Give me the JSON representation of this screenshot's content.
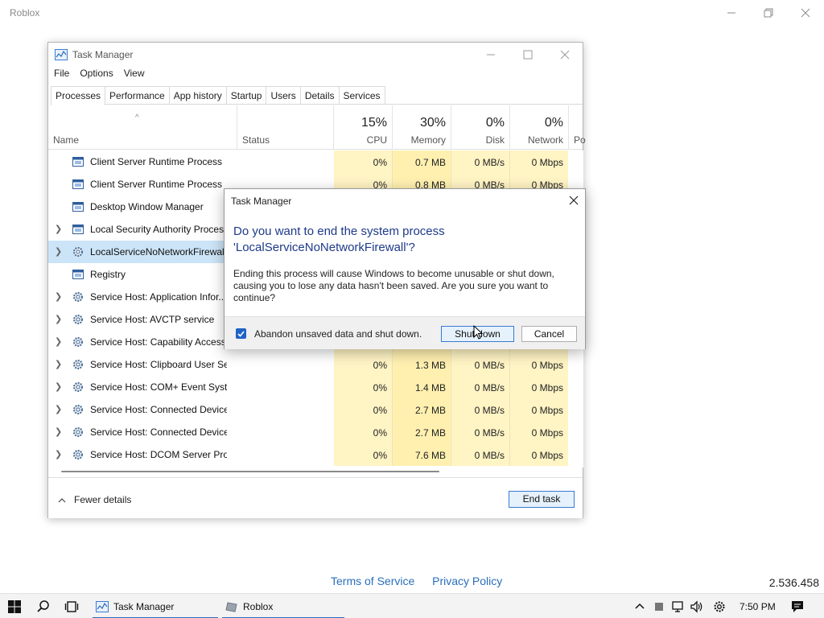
{
  "roblox": {
    "title": "Roblox",
    "links": {
      "terms": "Terms of Service",
      "privacy": "Privacy Policy"
    },
    "version": "2.536.458"
  },
  "task_manager": {
    "title": "Task Manager",
    "menu": [
      "File",
      "Options",
      "View"
    ],
    "tabs": [
      "Processes",
      "Performance",
      "App history",
      "Startup",
      "Users",
      "Details",
      "Services"
    ],
    "active_tab": "Processes",
    "columns": {
      "name": "Name",
      "status": "Status",
      "cpu": {
        "pct": "15%",
        "label": "CPU"
      },
      "memory": {
        "pct": "30%",
        "label": "Memory"
      },
      "disk": {
        "pct": "0%",
        "label": "Disk"
      },
      "network": {
        "pct": "0%",
        "label": "Network"
      },
      "power": "Po"
    },
    "processes": [
      {
        "name": "Client Server Runtime Process",
        "expandable": false,
        "icon": "window-app-icon",
        "cpu": "0%",
        "mem": "0.7 MB",
        "disk": "0 MB/s",
        "net": "0 Mbps"
      },
      {
        "name": "Client Server Runtime Process",
        "expandable": false,
        "icon": "window-app-icon",
        "cpu": "0%",
        "mem": "0.8 MB",
        "disk": "0 MB/s",
        "net": "0 Mbps"
      },
      {
        "name": "Desktop Window Manager",
        "expandable": false,
        "icon": "window-app-icon",
        "cpu": "",
        "mem": "",
        "disk": "",
        "net": ""
      },
      {
        "name": "Local Security Authority Process",
        "expandable": true,
        "icon": "window-app-icon",
        "cpu": "",
        "mem": "",
        "disk": "",
        "net": ""
      },
      {
        "name": "LocalServiceNoNetworkFirewall",
        "expandable": true,
        "icon": "gear-icon",
        "selected": true,
        "cpu": "",
        "mem": "",
        "disk": "",
        "net": ""
      },
      {
        "name": "Registry",
        "expandable": false,
        "icon": "window-app-icon",
        "cpu": "",
        "mem": "",
        "disk": "",
        "net": ""
      },
      {
        "name": "Service Host: Application Infor...",
        "expandable": true,
        "icon": "gear-icon",
        "cpu": "",
        "mem": "",
        "disk": "",
        "net": ""
      },
      {
        "name": "Service Host: AVCTP service",
        "expandable": true,
        "icon": "gear-icon",
        "cpu": "",
        "mem": "",
        "disk": "",
        "net": ""
      },
      {
        "name": "Service Host: Capability Access ...",
        "expandable": true,
        "icon": "gear-icon",
        "cpu": "",
        "mem": "",
        "disk": "",
        "net": ""
      },
      {
        "name": "Service Host: Clipboard User Ser...",
        "expandable": true,
        "icon": "gear-icon",
        "cpu": "0%",
        "mem": "1.3 MB",
        "disk": "0 MB/s",
        "net": "0 Mbps"
      },
      {
        "name": "Service Host: COM+ Event Syste...",
        "expandable": true,
        "icon": "gear-icon",
        "cpu": "0%",
        "mem": "1.4 MB",
        "disk": "0 MB/s",
        "net": "0 Mbps"
      },
      {
        "name": "Service Host: Connected Device...",
        "expandable": true,
        "icon": "gear-icon",
        "cpu": "0%",
        "mem": "2.7 MB",
        "disk": "0 MB/s",
        "net": "0 Mbps"
      },
      {
        "name": "Service Host: Connected Device...",
        "expandable": true,
        "icon": "gear-icon",
        "cpu": "0%",
        "mem": "2.7 MB",
        "disk": "0 MB/s",
        "net": "0 Mbps"
      },
      {
        "name": "Service Host: DCOM Server Proc...",
        "expandable": true,
        "icon": "gear-icon",
        "cpu": "0%",
        "mem": "7.6 MB",
        "disk": "0 MB/s",
        "net": "0 Mbps"
      }
    ],
    "footer": {
      "fewer_details": "Fewer details",
      "end_task": "End task"
    }
  },
  "dialog": {
    "title": "Task Manager",
    "main_instruction": "Do you want to end the system process 'LocalServiceNoNetworkFirewall'?",
    "body": "Ending this process will cause Windows to become unusable or shut down, causing you to lose any data hasn't been saved. Are you sure you want to continue?",
    "checkbox_label": "Abandon unsaved data and shut down.",
    "checkbox_checked": true,
    "shutdown_label": "Shut down",
    "cancel_label": "Cancel"
  },
  "taskbar": {
    "apps": [
      {
        "label": "Task Manager",
        "icon": "task-manager-icon"
      },
      {
        "label": "Roblox",
        "icon": "roblox-icon"
      }
    ],
    "time": "7:50 PM"
  },
  "colors": {
    "accent": "#2a6ebb",
    "heat_light": "#fff4c4",
    "heat_mem": "#fff0b0",
    "dialog_heading": "#1e3a8a"
  }
}
